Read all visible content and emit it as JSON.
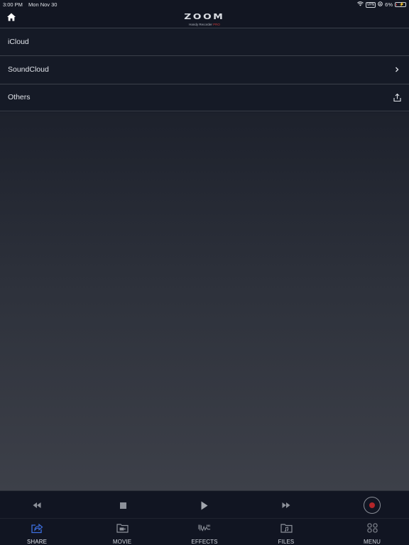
{
  "status_bar": {
    "time": "3:00 PM",
    "date": "Mon Nov 30",
    "vpn_label": "VPN",
    "battery_percent": "6%",
    "battery_level": 0.06
  },
  "header": {
    "brand": "ZOOM",
    "subtitle": "Handy Recorder",
    "subtitle_pro": "PRO",
    "home_icon": "home-icon"
  },
  "share_list": [
    {
      "label": "iCloud",
      "trailing_icon": null
    },
    {
      "label": "SoundCloud",
      "trailing_icon": "chevron-right-icon"
    },
    {
      "label": "Others",
      "trailing_icon": "share-upload-icon"
    }
  ],
  "transport": {
    "buttons": [
      "rewind-icon",
      "stop-icon",
      "play-icon",
      "fast-forward-icon",
      "record-icon"
    ],
    "record_color": "#b3262a"
  },
  "tabbar": {
    "active_color": "#3d6fe0",
    "active_tab": "SHARE",
    "tabs": [
      {
        "label": "SHARE",
        "icon": "share-icon"
      },
      {
        "label": "MOVIE",
        "icon": "movie-folder-icon"
      },
      {
        "label": "EFFECTS",
        "icon": "effects-waveform-icon"
      },
      {
        "label": "FILES",
        "icon": "files-folder-icon"
      },
      {
        "label": "MENU",
        "icon": "menu-grid-icon"
      }
    ]
  }
}
